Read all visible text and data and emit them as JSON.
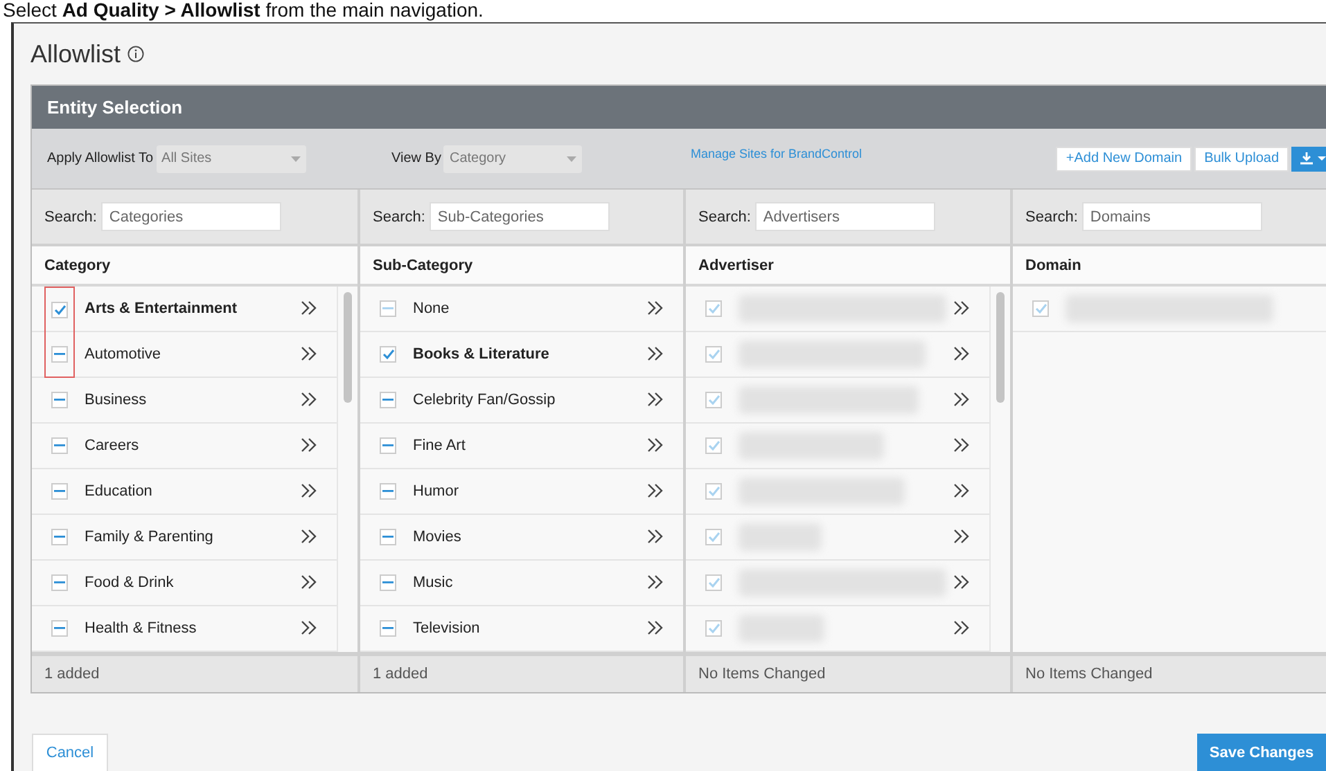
{
  "caption": "Select **Ad Quality > Allowlist** from the main navigation.",
  "page": {
    "title": "Allowlist"
  },
  "panel": {
    "title": "Entity Selection",
    "toolbar": {
      "apply_label": "Apply Allowlist To",
      "apply_value": "All Sites",
      "view_label": "View By",
      "view_value": "Category",
      "manage_link": "Manage Sites for BrandControl",
      "buttons": [
        "+Add New Domain",
        "Bulk Upload"
      ]
    },
    "columns": [
      {
        "search_label": "Search:",
        "search_placeholder": "Categories",
        "heading": "Category",
        "scrollable": true,
        "footer": "1 added",
        "items": [
          {
            "label": "Arts & Entertainment",
            "kind": "tick",
            "disabled": false,
            "highlighted": true,
            "expandable": true
          },
          {
            "label": "Automotive",
            "kind": "dash",
            "disabled": false,
            "highlighted": true,
            "expandable": true
          },
          {
            "label": "Business",
            "kind": "dash",
            "disabled": false,
            "highlighted": false,
            "expandable": true
          },
          {
            "label": "Careers",
            "kind": "dash",
            "disabled": false,
            "highlighted": false,
            "expandable": true
          },
          {
            "label": "Education",
            "kind": "dash",
            "disabled": false,
            "highlighted": false,
            "expandable": true
          },
          {
            "label": "Family & Parenting",
            "kind": "dash",
            "disabled": false,
            "highlighted": false,
            "expandable": true
          },
          {
            "label": "Food & Drink",
            "kind": "dash",
            "disabled": false,
            "highlighted": false,
            "expandable": true
          },
          {
            "label": "Health & Fitness",
            "kind": "dash",
            "disabled": false,
            "highlighted": false,
            "expandable": true
          }
        ]
      },
      {
        "search_label": "Search:",
        "search_placeholder": "Sub-Categories",
        "heading": "Sub-Category",
        "scrollable": false,
        "footer": "1 added",
        "items": [
          {
            "label": "None",
            "kind": "dash",
            "disabled": true,
            "highlighted": false,
            "expandable": true
          },
          {
            "label": "Books & Literature",
            "kind": "tick",
            "disabled": false,
            "highlighted": false,
            "expandable": true
          },
          {
            "label": "Celebrity Fan/Gossip",
            "kind": "dash",
            "disabled": false,
            "highlighted": false,
            "expandable": true
          },
          {
            "label": "Fine Art",
            "kind": "dash",
            "disabled": false,
            "highlighted": false,
            "expandable": true
          },
          {
            "label": "Humor",
            "kind": "dash",
            "disabled": false,
            "highlighted": false,
            "expandable": true
          },
          {
            "label": "Movies",
            "kind": "dash",
            "disabled": false,
            "highlighted": false,
            "expandable": true
          },
          {
            "label": "Music",
            "kind": "dash",
            "disabled": false,
            "highlighted": false,
            "expandable": true
          },
          {
            "label": "Television",
            "kind": "dash",
            "disabled": false,
            "highlighted": false,
            "expandable": true
          }
        ]
      },
      {
        "search_label": "Search:",
        "search_placeholder": "Advertisers",
        "heading": "Advertiser",
        "scrollable": true,
        "footer": "No Items Changed",
        "items": [
          {
            "kind": "tick",
            "disabled": true,
            "highlighted": false,
            "expandable": true
          },
          {
            "kind": "tick",
            "disabled": true,
            "highlighted": false,
            "expandable": true
          },
          {
            "kind": "tick",
            "disabled": true,
            "highlighted": false,
            "expandable": true
          },
          {
            "kind": "tick",
            "disabled": true,
            "highlighted": false,
            "expandable": true
          },
          {
            "kind": "tick",
            "disabled": true,
            "highlighted": false,
            "expandable": true
          },
          {
            "kind": "tick",
            "disabled": true,
            "highlighted": false,
            "expandable": true
          },
          {
            "kind": "tick",
            "disabled": true,
            "highlighted": false,
            "expandable": true
          },
          {
            "kind": "tick",
            "disabled": true,
            "highlighted": false,
            "expandable": true
          }
        ]
      },
      {
        "search_label": "Search:",
        "search_placeholder": "Domains",
        "heading": "Domain",
        "scrollable": false,
        "footer": "No Items Changed",
        "items": [
          {
            "kind": "tick",
            "disabled": true,
            "highlighted": false,
            "expandable": false
          }
        ]
      }
    ]
  },
  "footer": {
    "cancel": "Cancel",
    "save": "Save Changes"
  }
}
